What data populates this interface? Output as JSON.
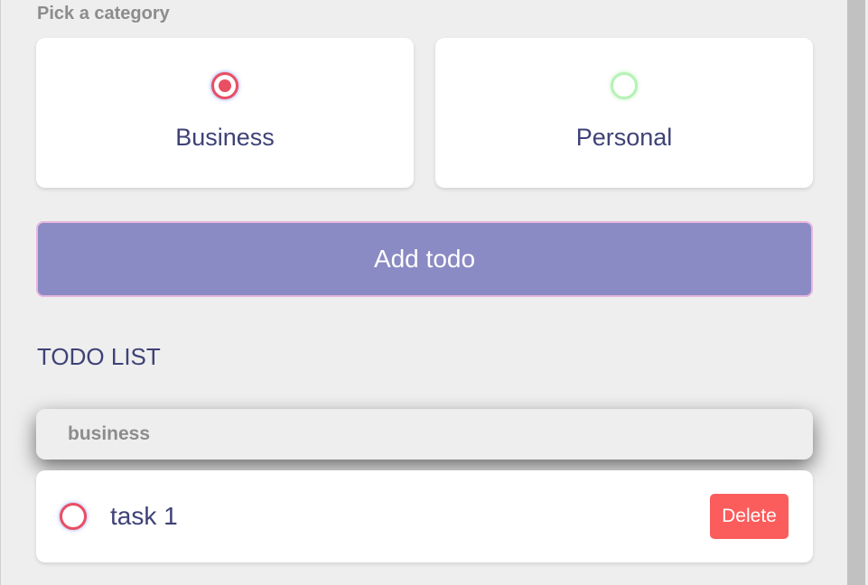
{
  "category": {
    "label": "Pick a category",
    "options": [
      {
        "label": "Business",
        "selected": true,
        "color": "#e94e63"
      },
      {
        "label": "Personal",
        "selected": false,
        "color": "#b6f2b6"
      }
    ]
  },
  "add_button": {
    "label": "Add todo",
    "color": "#8a8ac4"
  },
  "todo_list": {
    "title": "TODO LIST",
    "groups": [
      {
        "name": "business",
        "items": [
          {
            "text": "task 1",
            "done": false,
            "delete_label": "Delete"
          }
        ]
      }
    ]
  },
  "colors": {
    "text_primary": "#3f4277",
    "danger": "#fb5c5c"
  }
}
